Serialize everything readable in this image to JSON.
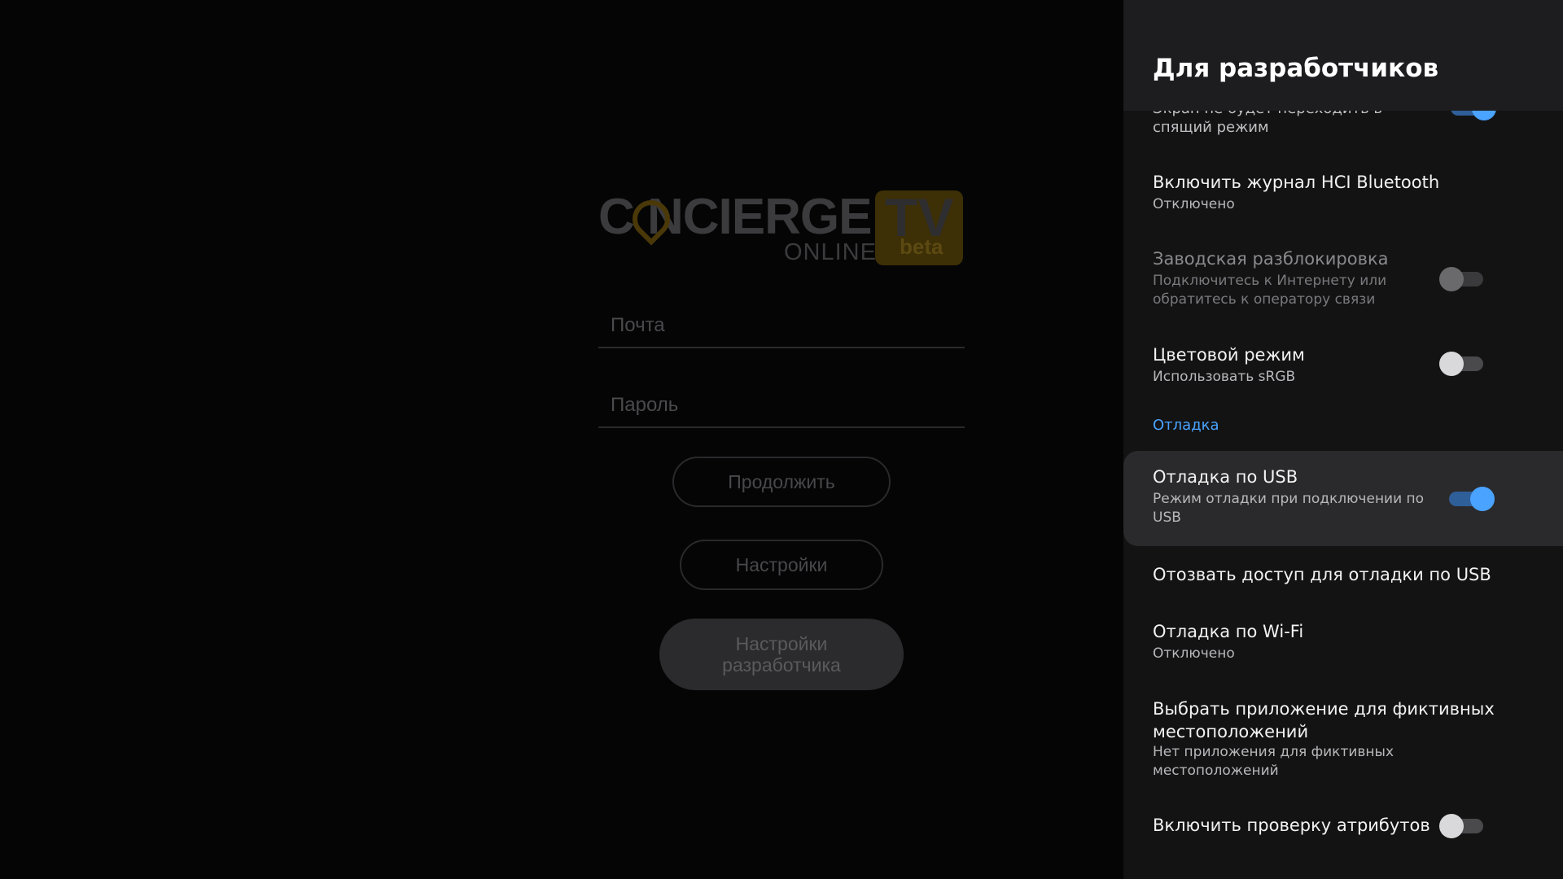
{
  "login": {
    "logo": {
      "word": "C NCIERGE",
      "online": "ONLINE",
      "tv": "TV",
      "beta": "beta"
    },
    "email_placeholder": "Почта",
    "password_placeholder": "Пароль",
    "continue_label": "Продолжить",
    "settings_label": "Настройки",
    "dev_settings_label": "Настройки\nразработчика"
  },
  "panel": {
    "title": "Для разработчиков",
    "items": [
      {
        "title": "",
        "subtitle": "Экран не будет переходить в спящий режим",
        "toggle": "on"
      },
      {
        "title": "Включить журнал HCI Bluetooth",
        "subtitle": "Отключено"
      },
      {
        "title": "Заводская разблокировка",
        "subtitle": "Подключитесь к Интернету или обратитесь к оператору связи",
        "toggle": "disabled"
      },
      {
        "title": "Цветовой режим",
        "subtitle": "Использовать sRGB",
        "toggle": "off"
      },
      {
        "section": "Отладка"
      },
      {
        "title": "Отладка по USB",
        "subtitle": "Режим отладки при подключении по USB",
        "toggle": "on",
        "focused": true
      },
      {
        "title": "Отозвать доступ для отладки по USB"
      },
      {
        "title": "Отладка по Wi-Fi",
        "subtitle": "Отключено"
      },
      {
        "title": "Выбрать приложение для фиктивных местоположений",
        "subtitle": "Нет приложения для фиктивных местоположений"
      },
      {
        "title": "Включить проверку атрибутов",
        "toggle": "off"
      }
    ]
  },
  "colors": {
    "accent": "#4aa3ff",
    "panel_bg": "#131314",
    "header_bg": "#1d1d1f"
  }
}
